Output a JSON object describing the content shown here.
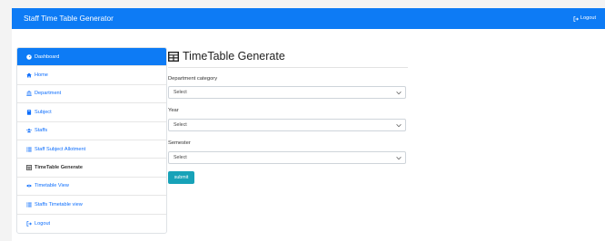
{
  "navbar": {
    "brand": "Staff Time Table Generator",
    "logout_label": "Logout"
  },
  "sidebar": {
    "items": [
      {
        "label": "Dashboard",
        "icon": "dashboard-icon"
      },
      {
        "label": "Home",
        "icon": "home-icon"
      },
      {
        "label": "Department",
        "icon": "bank-icon"
      },
      {
        "label": "Subject",
        "icon": "book-icon"
      },
      {
        "label": "Staffs",
        "icon": "users-icon"
      },
      {
        "label": "Staff Subject Allotment",
        "icon": "list-icon"
      },
      {
        "label": "TimeTable Generate",
        "icon": "table-icon"
      },
      {
        "label": "Timetable View",
        "icon": "eye-icon"
      },
      {
        "label": "Staffs Timetable view",
        "icon": "list-icon"
      },
      {
        "label": "Logout",
        "icon": "logout-icon"
      }
    ]
  },
  "main": {
    "title": "TimeTable Generate",
    "fields": [
      {
        "label": "Department category",
        "value": "Select"
      },
      {
        "label": "Year",
        "value": "Select"
      },
      {
        "label": "Semester",
        "value": "Select"
      }
    ],
    "submit_label": "submit"
  },
  "colors": {
    "primary": "#0d7bf5",
    "submit": "#17a2b8",
    "link": "#0d6efd"
  }
}
